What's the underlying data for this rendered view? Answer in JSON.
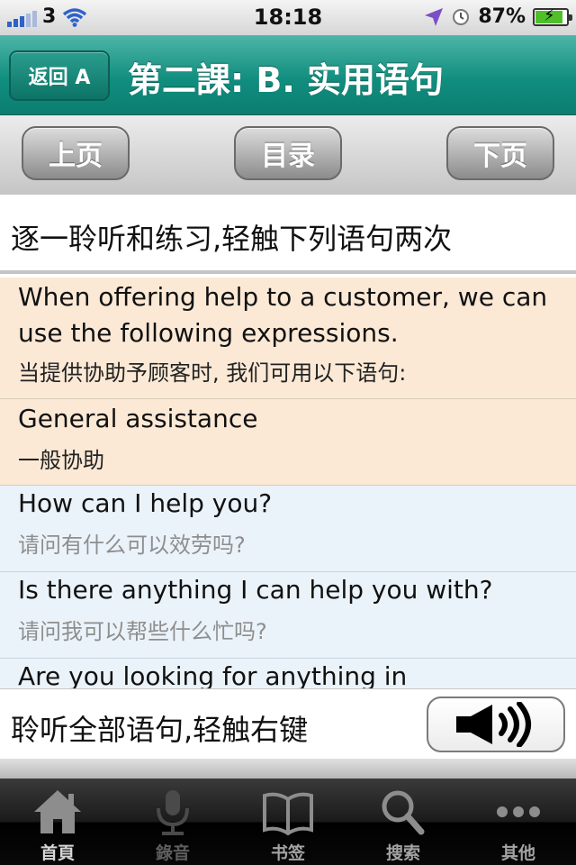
{
  "status_bar": {
    "carrier": "3",
    "time": "18:18",
    "battery": "87%",
    "battery_level": 0.87
  },
  "nav": {
    "back_label": "返回 A",
    "title": "第二課: B. 实用语句"
  },
  "toolbar": {
    "prev_label": "上页",
    "toc_label": "目录",
    "next_label": "下页"
  },
  "instruction": "逐一聆听和练习,轻触下列语句两次",
  "content": {
    "intro": {
      "en": "When offering help to a customer, we can use the following expressions.",
      "zh": "当提供协助予顾客时, 我们可用以下语句:"
    },
    "general": {
      "en": "General assistance",
      "zh": "一般协助"
    },
    "phrases": [
      {
        "en": "How can I help you?",
        "zh": "请问有什么可以效劳吗?"
      },
      {
        "en": "Is there anything I can help you with?",
        "zh": "请问我可以帮些什么忙吗?"
      }
    ],
    "partial": "Are you looking for anything in"
  },
  "listen_all": {
    "label": "聆听全部语句,轻触右键",
    "button_icon": "speaker-icon"
  },
  "tabs": [
    {
      "label": "首頁",
      "icon": "home-icon"
    },
    {
      "label": "錄音",
      "icon": "microphone-icon"
    },
    {
      "label": "书签",
      "icon": "book-icon"
    },
    {
      "label": "搜索",
      "icon": "search-icon"
    },
    {
      "label": "其他",
      "icon": "more-icon"
    }
  ],
  "colors": {
    "nav_teal": "#118e7f",
    "peach_row": "#fbe9d6",
    "blue_row": "#ebf3fa",
    "signal_blue": "#2f62c9",
    "battery_green": "#4fc02a"
  }
}
